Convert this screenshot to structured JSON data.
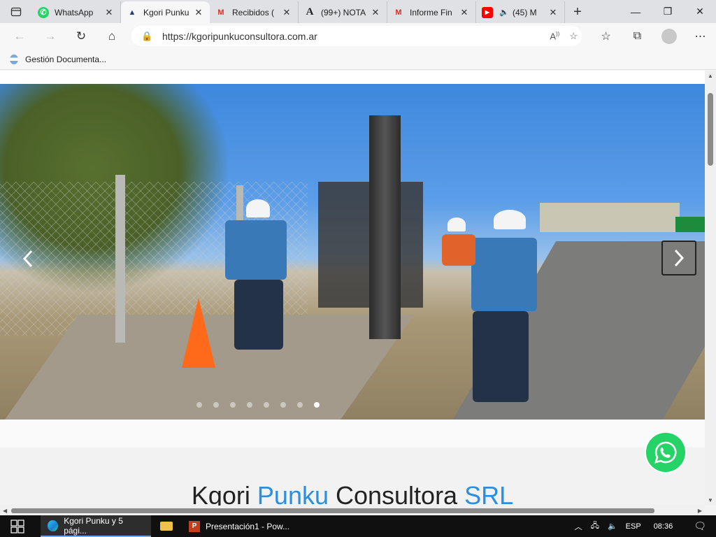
{
  "browser": {
    "tabs": [
      {
        "title": "WhatsApp",
        "icon": "whatsapp-icon",
        "active": false
      },
      {
        "title": "Kgori Punku",
        "icon": "kgori-logo-icon",
        "active": true
      },
      {
        "title": "Recibidos (",
        "icon": "gmail-icon",
        "active": false
      },
      {
        "title": "(99+) NOTA",
        "icon": "a-letter-icon",
        "active": false
      },
      {
        "title": "Informe Fin",
        "icon": "gmail-icon",
        "active": false
      },
      {
        "title": "(45) M",
        "icon": "youtube-icon",
        "active": false
      }
    ],
    "new_tab_label": "+",
    "url": "https://kgoripunkuconsultora.com.ar",
    "favorites": [
      {
        "label": "Gestión Documenta..."
      }
    ]
  },
  "page": {
    "slider": {
      "dot_count": 8,
      "active_dot": 7
    },
    "company_name_part1": "Kgori ",
    "company_name_part2": "Punku",
    "company_name_part3": " Consultora ",
    "company_name_part4": "SRL"
  },
  "taskbar": {
    "apps": [
      {
        "label": "Kgori Punku y 5 pági...",
        "icon": "edge-icon"
      },
      {
        "label": "",
        "icon": "folder-icon"
      },
      {
        "label": "Presentación1 - Pow...",
        "icon": "powerpoint-icon"
      }
    ],
    "language": "ESP",
    "time": "08:36"
  },
  "colors": {
    "accent": "#2a8fe0",
    "whatsapp": "#25d366",
    "tabbar": "#dfe1e5"
  }
}
